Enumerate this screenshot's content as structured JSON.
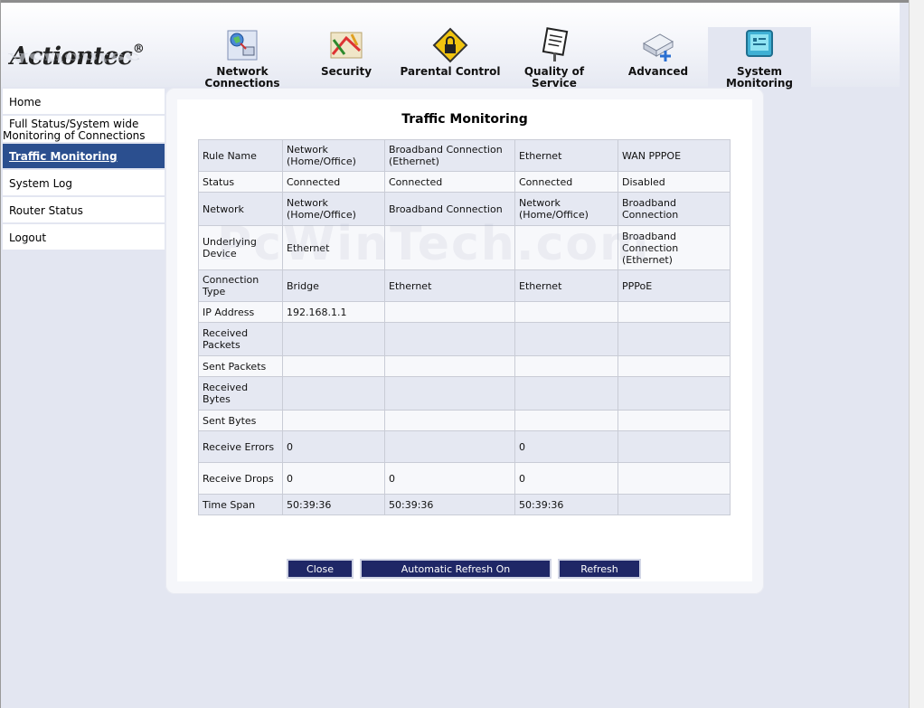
{
  "brand": {
    "name": "Actiontec",
    "reg": "®"
  },
  "nav": [
    {
      "label": "Network Connections",
      "icon": "network-connections-icon",
      "active": false
    },
    {
      "label": "Security",
      "icon": "security-icon",
      "active": false
    },
    {
      "label": "Parental Control",
      "icon": "lock-icon",
      "active": false
    },
    {
      "label": "Quality of Service",
      "icon": "traffic-sign-icon",
      "active": false
    },
    {
      "label": "Advanced",
      "icon": "advanced-icon",
      "active": false
    },
    {
      "label": "System Monitoring",
      "icon": "monitor-icon",
      "active": true
    }
  ],
  "sidebar": [
    {
      "label": "Home"
    },
    {
      "label": "Full Status/System wide Monitoring of Connections",
      "line1": "Full Status/System wide",
      "line2": "Monitoring of Connections"
    },
    {
      "label": "Traffic Monitoring",
      "active": true
    },
    {
      "label": "System Log"
    },
    {
      "label": "Router Status"
    },
    {
      "label": "Logout"
    }
  ],
  "panel": {
    "title": "Traffic Monitoring"
  },
  "table": {
    "rows": [
      {
        "label": "Rule Name",
        "cells": [
          "Network (Home/Office)",
          "Broadband Connection (Ethernet)",
          "Ethernet",
          "WAN PPPOE"
        ],
        "style": "link"
      },
      {
        "label": "Status",
        "cells": [
          "Connected",
          "Connected",
          "Connected",
          "Disabled"
        ],
        "style": "status"
      },
      {
        "label": "Network",
        "cells": [
          "Network (Home/Office)",
          "Broadband Connection",
          "Network (Home/Office)",
          "Broadband Connection"
        ]
      },
      {
        "label": "Underlying Device",
        "cells": [
          "Ethernet",
          "",
          "",
          "Broadband Connection (Ethernet)"
        ],
        "style": "link"
      },
      {
        "label": "Connection Type",
        "cells": [
          "Bridge",
          "Ethernet",
          "Ethernet",
          "PPPoE"
        ]
      },
      {
        "label": "IP Address",
        "cells": [
          "192.168.1.1",
          "",
          "",
          ""
        ]
      },
      {
        "label": "Received Packets",
        "cells": [
          "",
          "",
          "",
          ""
        ]
      },
      {
        "label": "Sent Packets",
        "cells": [
          "",
          "",
          "",
          ""
        ]
      },
      {
        "label": "Received Bytes",
        "cells": [
          "",
          "",
          "",
          ""
        ]
      },
      {
        "label": "Sent Bytes",
        "cells": [
          "",
          "",
          "",
          ""
        ]
      },
      {
        "label": "Receive Errors",
        "cells": [
          "0",
          "",
          "0",
          ""
        ]
      },
      {
        "label": "Receive Drops",
        "cells": [
          "0",
          "0",
          "0",
          ""
        ]
      },
      {
        "label": "Time Span",
        "cells": [
          "50:39:36",
          "50:39:36",
          "50:39:36",
          ""
        ]
      }
    ]
  },
  "buttons": {
    "close": "Close",
    "auto_refresh": "Automatic Refresh On",
    "refresh": "Refresh"
  },
  "watermark": "PcWinTech.com"
}
